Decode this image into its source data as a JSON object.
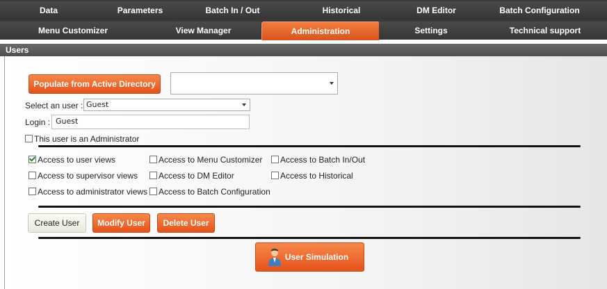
{
  "tabs": {
    "row1": [
      "Data",
      "Parameters",
      "Batch In / Out",
      "Historical",
      "DM Editor",
      "Batch Configuration"
    ],
    "row2": [
      "Menu Customizer",
      "View Manager",
      "Administration",
      "Settings",
      "Technical support"
    ],
    "active": "Administration"
  },
  "section": {
    "title": "Users"
  },
  "ad": {
    "button_label": "Populate from Active Directory",
    "select_value": ""
  },
  "user_select": {
    "label": "Select an user :",
    "value": "Guest"
  },
  "login": {
    "label": "Login :",
    "value": "Guest"
  },
  "admin_checkbox": {
    "label": "This user is an Administrator",
    "checked": false
  },
  "permissions": [
    {
      "label": "Access to user views",
      "checked": true
    },
    {
      "label": "Access to Menu Customizer",
      "checked": false
    },
    {
      "label": "Access to Batch In/Out",
      "checked": false
    },
    {
      "label": "Access to supervisor views",
      "checked": false
    },
    {
      "label": "Access to DM Editor",
      "checked": false
    },
    {
      "label": "Access to Historical",
      "checked": false
    },
    {
      "label": "Access to administrator views",
      "checked": false
    },
    {
      "label": "Access to Batch Configuration",
      "checked": false
    }
  ],
  "actions": {
    "create": "Create User",
    "modify": "Modify User",
    "delete": "Delete User"
  },
  "simulation": {
    "label": "User Simulation"
  },
  "colors": {
    "accent": "#e8601f",
    "tab_bar": "#3a3a3a",
    "section_bar": "#5a5a5a"
  }
}
